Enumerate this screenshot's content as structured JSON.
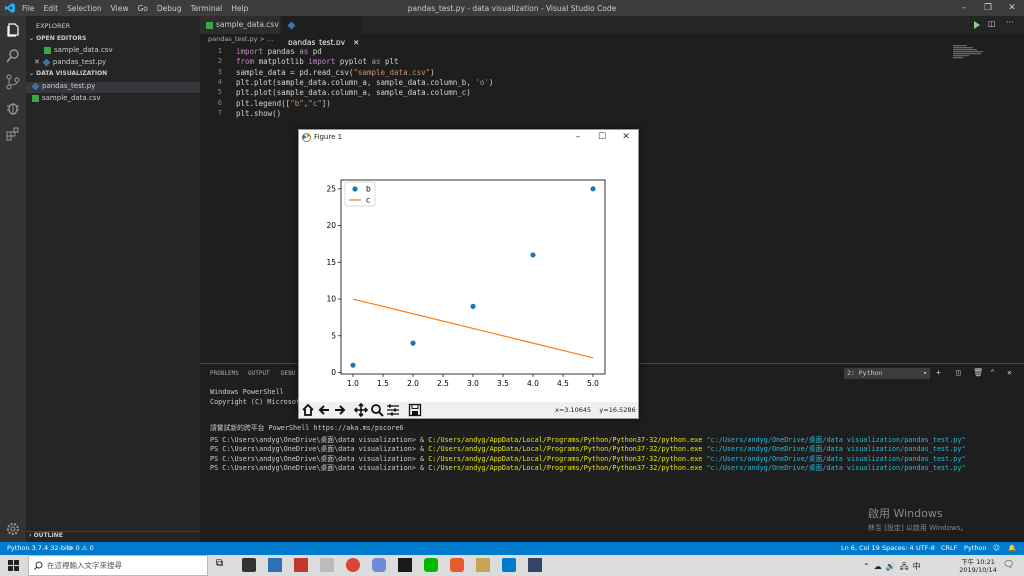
{
  "app": {
    "menu": [
      "File",
      "Edit",
      "Selection",
      "View",
      "Go",
      "Debug",
      "Terminal",
      "Help"
    ],
    "window_title": "pandas_test.py - data visualization - Visual Studio Code"
  },
  "sidebar": {
    "header": "EXPLORER",
    "open_editors": "OPEN EDITORS",
    "open_files": [
      "sample_data.csv",
      "pandas_test.py"
    ],
    "folder": "DATA VISUALIZATION",
    "files": [
      "pandas_test.py",
      "sample_data.csv"
    ],
    "outline": "OUTLINE"
  },
  "tabs": [
    "sample_data.csv",
    "pandas_test.py"
  ],
  "breadcrumb": "pandas_test.py > ...",
  "code": [
    {
      "n": "1",
      "parts": [
        [
          "kw",
          "import"
        ],
        [
          "",
          " pandas "
        ],
        [
          "kw",
          "as"
        ],
        [
          "",
          " pd"
        ]
      ]
    },
    {
      "n": "2",
      "parts": [
        [
          "kw",
          "from"
        ],
        [
          "",
          " matplotlib "
        ],
        [
          "kw",
          "import"
        ],
        [
          "",
          " pyplot "
        ],
        [
          "kw",
          "as"
        ],
        [
          "",
          " plt"
        ]
      ]
    },
    {
      "n": "3",
      "parts": [
        [
          "",
          "sample_data = pd.read_csv("
        ],
        [
          "str",
          "\"sample_data.csv\""
        ],
        [
          "",
          ")"
        ]
      ]
    },
    {
      "n": "4",
      "parts": [
        [
          "",
          "plt.plot(sample_data.column_a, sample_data.column_b, "
        ],
        [
          "str",
          "'o'"
        ],
        [
          "",
          ")"
        ]
      ]
    },
    {
      "n": "5",
      "parts": [
        [
          "",
          "plt.plot(sample_data.column_a, sample_data.column_c)"
        ]
      ]
    },
    {
      "n": "6",
      "parts": [
        [
          "",
          "plt.legend(["
        ],
        [
          "str",
          "\"b\""
        ],
        [
          "",
          ","
        ],
        [
          "str",
          "\"c\""
        ],
        [
          "",
          "])"
        ]
      ]
    },
    {
      "n": "7",
      "parts": [
        [
          "",
          "plt.show()"
        ]
      ]
    }
  ],
  "panel": {
    "tabs": [
      "PROBLEMS",
      "OUTPUT",
      "DEBU"
    ],
    "terminal_select": "2: Python",
    "lines": [
      "Windows PowerShell",
      "Copyright (C) Microsoft",
      "",
      "請嘗試新的跨平台 PowerShell https://aka.ms/pscore6",
      ""
    ],
    "ps_prompt": "PS C:\\Users\\andyg\\OneDrive\\桌面\\data visualization> & ",
    "ps_exe": "C:/Users/andyg/AppData/Local/Programs/Python/Python37-32/python.exe",
    "ps_arg": " \"c:/Users/andyg/OneDrive/桌面/data visualization/pandas_test.py\"",
    "ps_count": 4
  },
  "watermark": {
    "title": "啟用 Windows",
    "sub": "移至 [設定] 以啟用 Windows。"
  },
  "statusbar": {
    "python": "Python 3.7.4 32-bit",
    "problems": "⊗ 0 ⚠ 0",
    "position": "Ln 6, Col 19",
    "spaces": "Spaces: 4",
    "encoding": "UTF-8",
    "eol": "CRLF",
    "language": "Python"
  },
  "taskbar": {
    "search": "在這裡輸入文字來搜尋",
    "time": "下午 10:21",
    "date": "2019/10/14"
  },
  "figure": {
    "title": "Figure 1",
    "coords": "x=3.10645    y=16.5286"
  },
  "chart_data": {
    "type": "line",
    "x": [
      1,
      2,
      3,
      4,
      5
    ],
    "series": [
      {
        "name": "b",
        "style": "markers",
        "color": "#1f77b4",
        "values": [
          1,
          4,
          9,
          16,
          25
        ]
      },
      {
        "name": "c",
        "style": "line",
        "color": "#ff7f0e",
        "values": [
          10,
          8,
          6,
          4,
          2
        ]
      }
    ],
    "xticks": [
      "1.0",
      "1.5",
      "2.0",
      "2.5",
      "3.0",
      "3.5",
      "4.0",
      "4.5",
      "5.0"
    ],
    "yticks": [
      "0",
      "5",
      "10",
      "15",
      "20",
      "25"
    ],
    "xlim": [
      0.8,
      5.2
    ],
    "ylim": [
      -0.2,
      26.2
    ],
    "legend": "upper left"
  }
}
